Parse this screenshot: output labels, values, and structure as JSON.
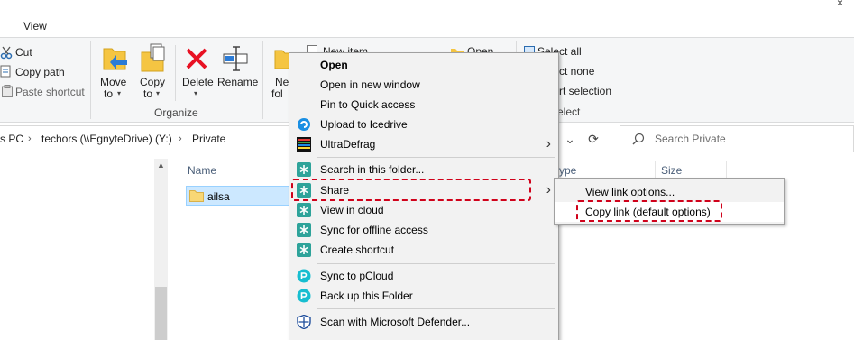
{
  "window": {
    "close_glyph": "×"
  },
  "ribbon": {
    "tab_view": "View",
    "clipboard": {
      "cut": "Cut",
      "copy_path": "Copy path",
      "paste_shortcut": "Paste shortcut"
    },
    "organize": {
      "move_to": "Move",
      "move_to_2": "to",
      "copy_to": "Copy",
      "copy_to_2": "to",
      "delete": "Delete",
      "rename": "Rename",
      "group_label": "Organize"
    },
    "new": {
      "new_folder_1": "Ne",
      "new_folder_2": "fol",
      "new_item": "New item"
    },
    "open": {
      "open": "Open"
    },
    "select": {
      "select_all": "Select all",
      "select_none": "ct none",
      "invert": "rt selection",
      "group_label": "elect"
    }
  },
  "address": {
    "segments": [
      "s PC",
      "techors (\\\\EgnyteDrive) (Y:)",
      "Private"
    ],
    "search_placeholder": "Search Private"
  },
  "filelist": {
    "columns": {
      "name": "Name",
      "type": "ype",
      "size": "Size"
    },
    "rows": [
      {
        "name": "ailsa"
      }
    ]
  },
  "context_menu": {
    "items": [
      {
        "label": "Open",
        "bold": true
      },
      {
        "label": "Open in new window"
      },
      {
        "label": "Pin to Quick access"
      },
      {
        "label": "Upload to Icedrive",
        "icon": "icedrive-icon"
      },
      {
        "label": "UltraDefrag",
        "icon": "ultradefrag-icon"
      },
      {
        "label": "Search in this folder...",
        "icon": "egnyte-icon"
      },
      {
        "label": "Share",
        "icon": "egnyte-icon"
      },
      {
        "label": "View in cloud",
        "icon": "egnyte-icon"
      },
      {
        "label": "Sync for offline access",
        "icon": "egnyte-icon"
      },
      {
        "label": "Create shortcut",
        "icon": "egnyte-icon"
      },
      {
        "label": "Sync to pCloud",
        "icon": "pcloud-icon"
      },
      {
        "label": "Back up this Folder",
        "icon": "pcloud-icon"
      },
      {
        "label": "Scan with Microsoft Defender...",
        "icon": "defender-icon"
      }
    ]
  },
  "share_submenu": {
    "items": [
      {
        "label": "View link options..."
      },
      {
        "label": "Copy link (default options)"
      }
    ]
  },
  "colors": {
    "highlight": "#d0021b",
    "selection": "#cce8ff",
    "egnyte": "#2ea39a",
    "delete": "#e81123"
  }
}
